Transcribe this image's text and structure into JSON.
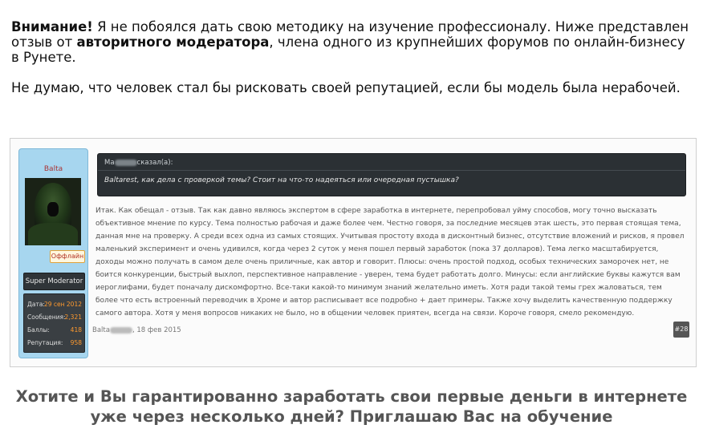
{
  "intro": {
    "p1_warning": "Внимание!",
    "p1_part1": " Я не побоялся дать свою методику на изучение профессионалу. Ниже представлен отзыв от ",
    "p1_bold": "авторитного модератора",
    "p1_part2": ", члена одного из крупнейших форумов по онлайн-бизнесу в Рунете.",
    "p2": "Не думаю, что человек стал бы рисковать своей репутацией, если бы модель была нерабочей."
  },
  "forum": {
    "username": "Balta",
    "status_label": "Оффлайн",
    "role": "Super Moderator",
    "stats": [
      {
        "label": "Дата:",
        "value": "29 сен 2012"
      },
      {
        "label": "Сообщения:",
        "value": "2,321"
      },
      {
        "label": "Баллы:",
        "value": "418"
      },
      {
        "label": "Репутация:",
        "value": "958"
      }
    ],
    "quote_author": "Ma",
    "quote_suffix": "сказал(а):",
    "quote_text": "Baltarest, как дела с проверкой темы? Стоит на что-то надеяться или очередная пустышка?",
    "post_text": "Итак. Как обещал - отзыв. Так как давно являюсь экспертом в сфере заработка в интернете, перепробовал уйму способов, могу точно высказать объективное мнение по курсу. Тема полностью рабочая и даже более чем. Честно говоря, за последние месяцев этак шесть, это первая стоящая тема, данная мне на проверку. А среди всех одна из самых стоящих. Учитывая простоту входа в дисконтный бизнес, отсутствие вложений и рисков, я провел маленький эксперимент и очень удивился, когда через 2 суток у меня пошел первый заработок (пока 37 долларов). Тема легко масштабируется, доходы можно получать в самом деле очень приличные, как автор и говорит. Плюсы: очень простой подход, особых технических заморочек нет, не боится конкуренции, быстрый выхлоп, перспективное направление - уверен, тема будет работать долго. Минусы: если английские буквы кажутся вам иероглифами, будет поначалу дискомфортно. Все-таки какой-то минимум знаний желательно иметь. Хотя ради такой темы грех жаловаться, тем более что есть встроенный переводчик в Хроме и автор расписывает все подробно + дает примеры. Также хочу выделить качественную поддержку самого автора. Хотя у меня вопросов никаких не было, но в общении человек приятен, всегда на связи. Короче говоря, смело рекомендую.",
    "post_author": "Balta",
    "post_date": ", 18 фев 2015",
    "post_number": "#28"
  },
  "cta": "Хотите и Вы гарантированно заработать свои первые деньги в интернете уже через несколько дней? Приглашаю Вас на обучение"
}
